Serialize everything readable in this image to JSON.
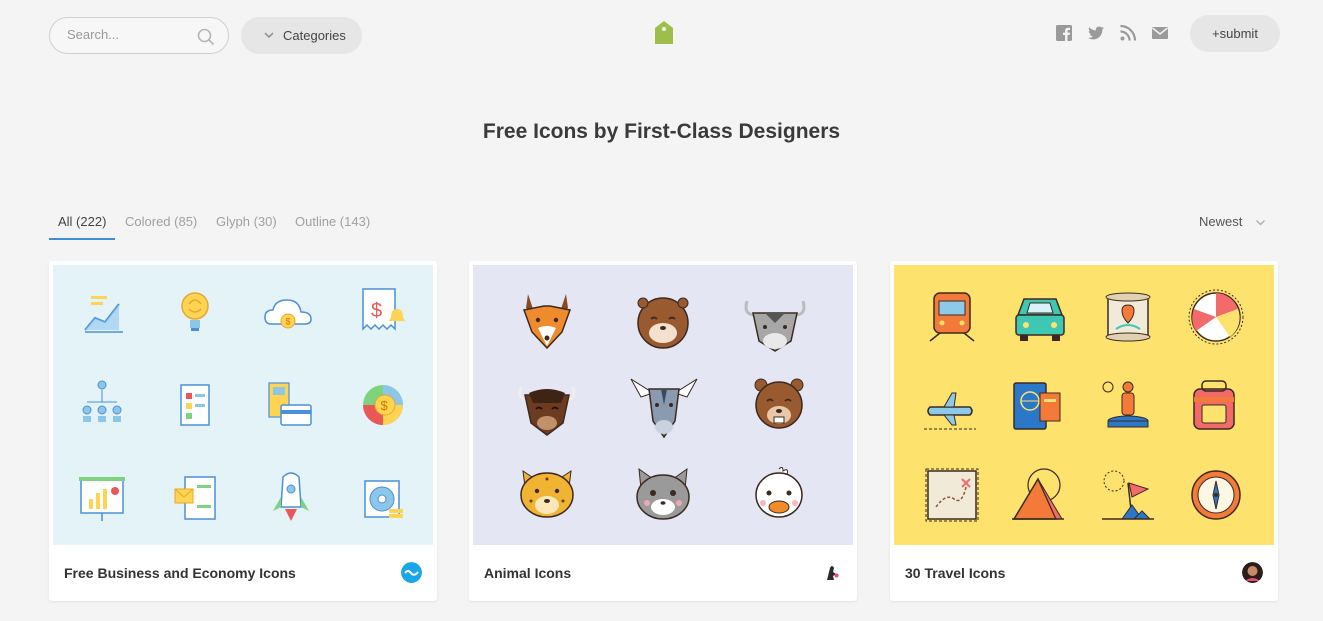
{
  "header": {
    "search_placeholder": "Search...",
    "categories_label": "Categories",
    "submit_label": "+submit",
    "logo_icon": "tag-icon",
    "logo_color": "#9dbf4a",
    "social_icons": [
      "facebook-icon",
      "twitter-icon",
      "rss-icon",
      "mail-icon"
    ]
  },
  "hero": {
    "title": "Free Icons by First-Class Designers"
  },
  "filters": {
    "tabs": [
      {
        "label": "All (222)",
        "active": true
      },
      {
        "label": "Colored (85)",
        "active": false
      },
      {
        "label": "Glyph (30)",
        "active": false
      },
      {
        "label": "Outline (143)",
        "active": false
      }
    ],
    "sort_label": "Newest",
    "accent_color": "#3d8fd6"
  },
  "cards": [
    {
      "title": "Free Business and Economy Icons",
      "thumb_color": "#e3f3f7"
    },
    {
      "title": "Animal Icons",
      "thumb_color": "#e4e6f4"
    },
    {
      "title": "30 Travel Icons",
      "thumb_color": "#fde36e"
    }
  ]
}
